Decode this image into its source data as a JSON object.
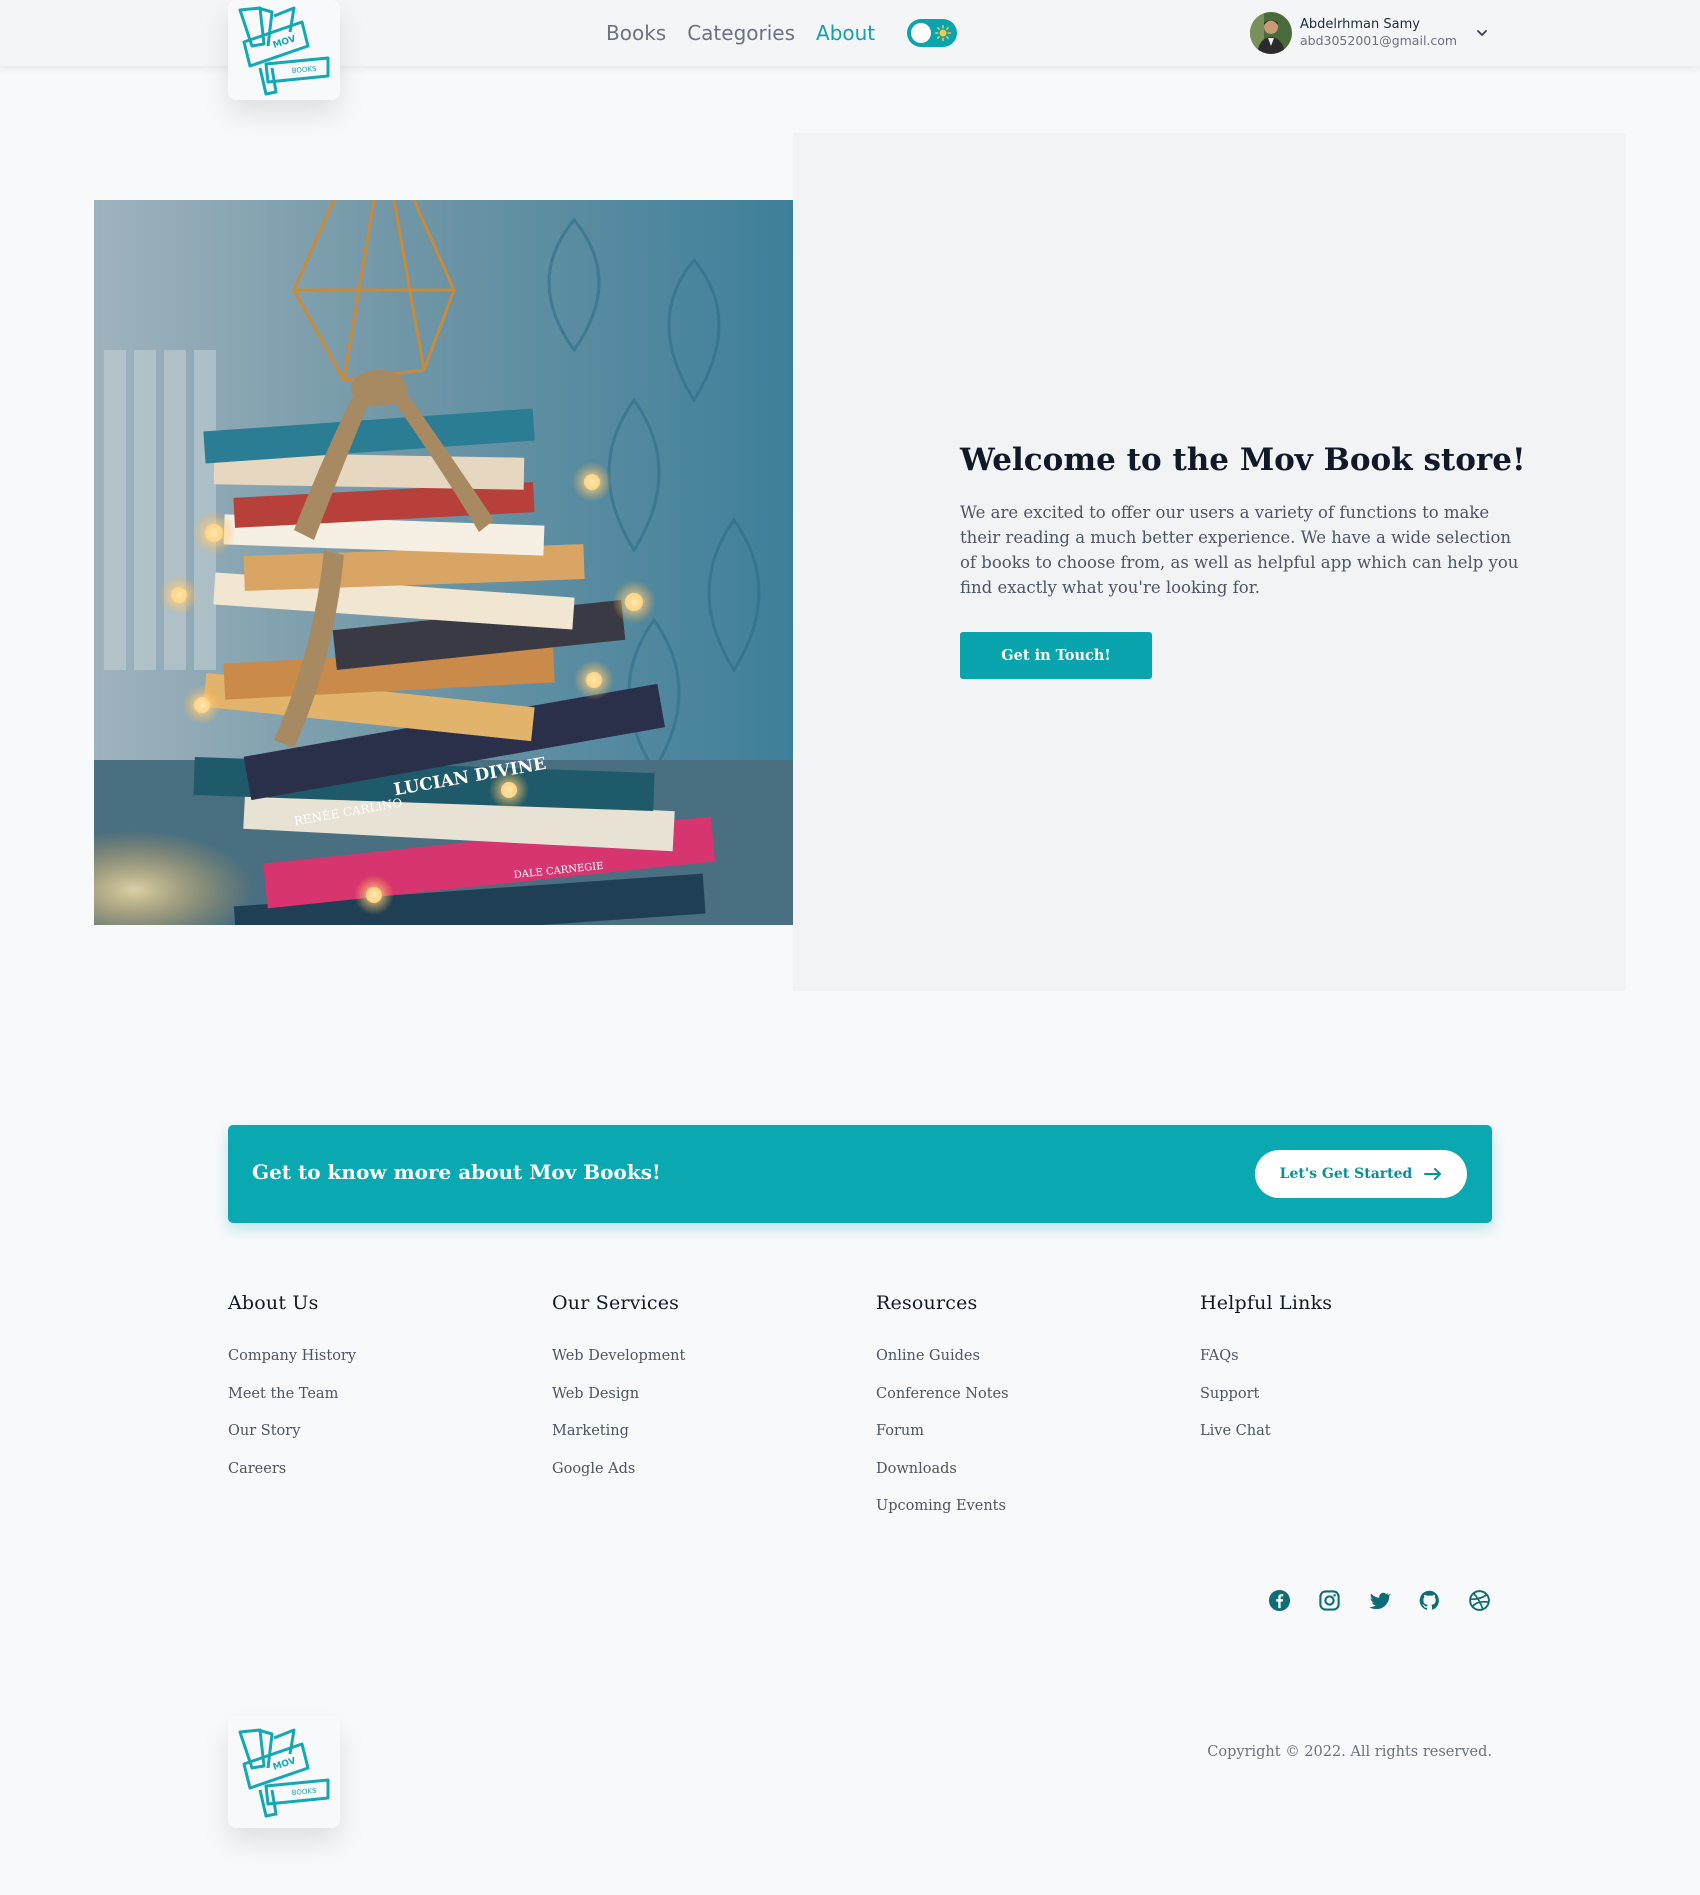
{
  "brand": {
    "logo_top_text": "MOV",
    "logo_bottom_text": "BOOKS",
    "accent": "#0aa4ae"
  },
  "nav": {
    "links": [
      {
        "label": "Books",
        "active": false
      },
      {
        "label": "Categories",
        "active": false
      },
      {
        "label": "About",
        "active": true
      }
    ],
    "theme_toggle_icon": "sun-icon"
  },
  "user": {
    "name": "Abdelrhman Samy",
    "email": "abd3052001@gmail.com",
    "menu_icon": "chevron-down-icon"
  },
  "hero": {
    "title": "Welcome to the Mov Book store!",
    "text": "We are excited to offer our users a variety of functions to make their reading a much better experience. We have a wide selection of books to choose from, as well as helpful app which can help you find exactly what you're looking for.",
    "button_label": "Get in Touch!",
    "image_book_text_1": "LUCIAN DIVINE",
    "image_book_text_2": "RENÉE CARLINO",
    "image_book_text_3": "DALE CARNEGIE"
  },
  "cta": {
    "title": "Get to know more about Mov Books!",
    "button_label": "Let's Get Started",
    "button_icon": "arrow-right-icon"
  },
  "footer": {
    "columns": [
      {
        "title": "About Us",
        "items": [
          "Company History",
          "Meet the Team",
          "Our Story",
          "Careers"
        ]
      },
      {
        "title": "Our Services",
        "items": [
          "Web Development",
          "Web Design",
          "Marketing",
          "Google Ads"
        ]
      },
      {
        "title": "Resources",
        "items": [
          "Online Guides",
          "Conference Notes",
          "Forum",
          "Downloads",
          "Upcoming Events"
        ]
      },
      {
        "title": "Helpful Links",
        "items": [
          "FAQs",
          "Support",
          "Live Chat"
        ]
      }
    ],
    "social_icons": [
      "facebook-icon",
      "instagram-icon",
      "twitter-icon",
      "github-icon",
      "dribbble-icon"
    ],
    "copyright": "Copyright © 2022. All rights reserved."
  }
}
